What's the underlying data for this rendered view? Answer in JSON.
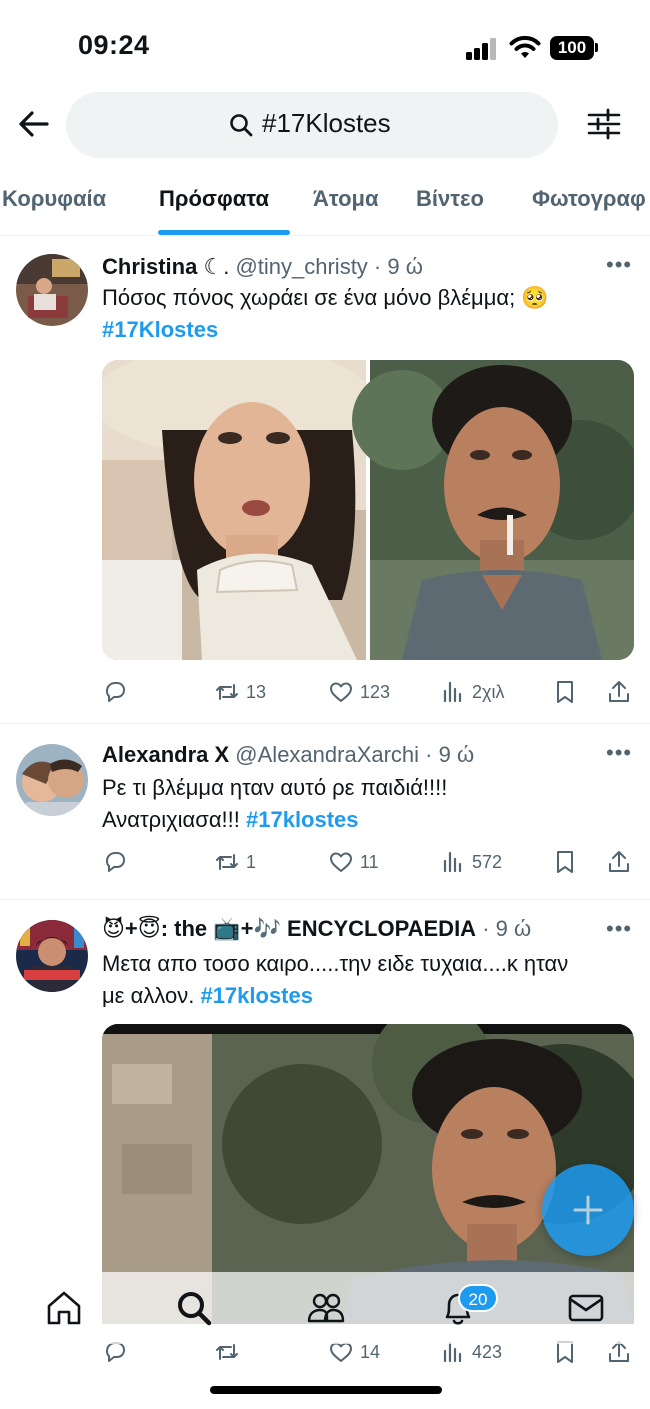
{
  "status_bar": {
    "time": "09:24",
    "battery": "100"
  },
  "search": {
    "query": "#17Klostes"
  },
  "tabs": [
    {
      "label": "Κορυφαία"
    },
    {
      "label": "Πρόσφατα"
    },
    {
      "label": "Άτομα"
    },
    {
      "label": "Βίντεο"
    },
    {
      "label": "Φωτογραφ"
    }
  ],
  "tweets": [
    {
      "name": "Christina",
      "name_extra": " ☾.",
      "handle": "@tiny_christy",
      "time": "9 ώ",
      "text": "Πόσος πόνος χωράει σε ένα μόνο βλέμμα; 🥺",
      "hashtag": "#17Klostes",
      "replies": "",
      "retweets": "13",
      "likes": "123",
      "views": "2χιλ"
    },
    {
      "name": "Alexandra X",
      "handle": "@AlexandraXarchi",
      "time": "9 ώ",
      "text": "Ρε τι βλέμμα ηταν αυτό ρε παιδιά!!!!",
      "text2": "Ανατριχιασα!!! ",
      "hashtag": "#17klostes",
      "replies": "",
      "retweets": "1",
      "likes": "11",
      "views": "572"
    },
    {
      "name_prefix": "😈+😇: the 📺+🎶",
      "name": " ENCYCLOPAEDIA",
      "time": "9 ώ",
      "text": "Μετα απο τοσο καιρο.....την ειδε τυχαια....κ ηταν",
      "text2": "με αλλον. ",
      "hashtag": "#17klostes",
      "replies": "",
      "retweets": "",
      "likes": "14",
      "views": "423"
    }
  ],
  "nav": {
    "notifications_badge": "20"
  },
  "colors": {
    "accent": "#1d9bf0",
    "text": "#0f1419",
    "muted": "#536471"
  },
  "icons": [
    "back-arrow-icon",
    "search-icon",
    "filter-icon",
    "reply-icon",
    "retweet-icon",
    "like-icon",
    "views-icon",
    "bookmark-icon",
    "share-icon",
    "plus-icon",
    "home-icon",
    "people-icon",
    "bell-icon",
    "mail-icon"
  ]
}
